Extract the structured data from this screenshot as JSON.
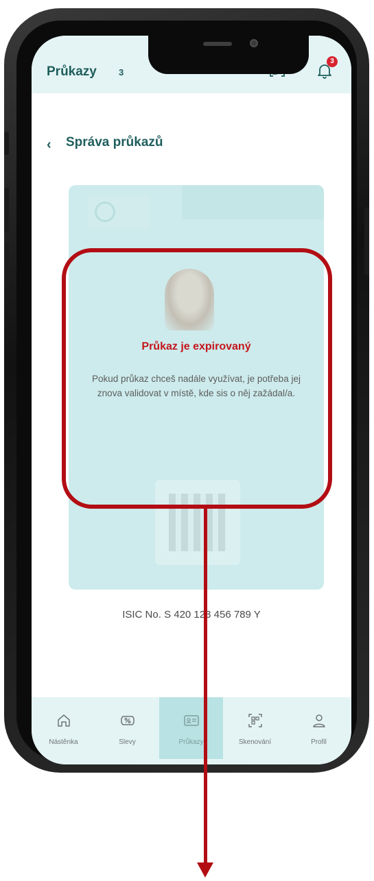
{
  "header": {
    "title": "Průkazy",
    "count": "3",
    "notification_count": "3"
  },
  "subheader": {
    "back_icon": "chevron-left-icon",
    "title": "Správa průkazů"
  },
  "expired_notice": {
    "title": "Průkaz je expirovaný",
    "message": "Pokud průkaz chceš nadále využívat, je potřeba jej znova validovat v místě, kde sis o něj zažádal/a."
  },
  "card": {
    "isic_number": "ISIC No.  S 420 123 456 789 Y"
  },
  "tabs": [
    {
      "label": "Nástěnka",
      "icon": "home-icon",
      "active": false
    },
    {
      "label": "Slevy",
      "icon": "discount-icon",
      "active": false
    },
    {
      "label": "Průkazy",
      "icon": "id-card-icon",
      "active": true
    },
    {
      "label": "Skenování",
      "icon": "qr-scan-icon",
      "active": false
    },
    {
      "label": "Profil",
      "icon": "user-icon",
      "active": false
    }
  ],
  "colors": {
    "accent": "#1f5e5c",
    "tint": "#e4f4f4",
    "alert": "#c4161c",
    "annotation": "#b30d14"
  }
}
